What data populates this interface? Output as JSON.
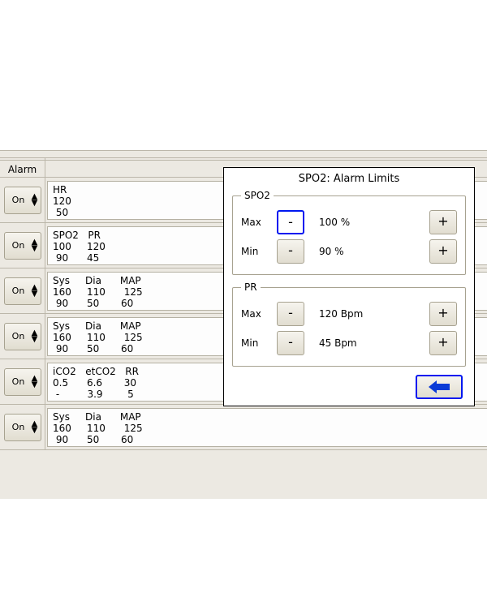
{
  "alarm_header": "Alarm",
  "hidden_header": "Alarm Limits",
  "rows": [
    {
      "on": "On",
      "text": "HR\n120\n 50"
    },
    {
      "on": "On",
      "text": "SPO2   PR\n100     120\n 90      45"
    },
    {
      "on": "On",
      "text": "Sys     Dia      MAP\n160     110      125\n 90      50       60"
    },
    {
      "on": "On",
      "text": "Sys     Dia      MAP\n160     110      125\n 90      50       60"
    },
    {
      "on": "On",
      "text": "iCO2   etCO2   RR\n0.5      6.6       30\n -         3.9        5"
    },
    {
      "on": "On",
      "text": "Sys     Dia      MAP\n160     110      125\n 90      50       60"
    }
  ],
  "popup": {
    "title": "SPO2: Alarm Limits",
    "groups": [
      {
        "name": "SPO2",
        "limits": [
          {
            "label": "Max",
            "value": "100 %",
            "minus_focused": true
          },
          {
            "label": "Min",
            "value": "90 %",
            "minus_focused": false
          }
        ]
      },
      {
        "name": "PR",
        "limits": [
          {
            "label": "Max",
            "value": "120 Bpm",
            "minus_focused": false
          },
          {
            "label": "Min",
            "value": "45 Bpm",
            "minus_focused": false
          }
        ]
      }
    ],
    "minus": "-",
    "plus": "+"
  }
}
